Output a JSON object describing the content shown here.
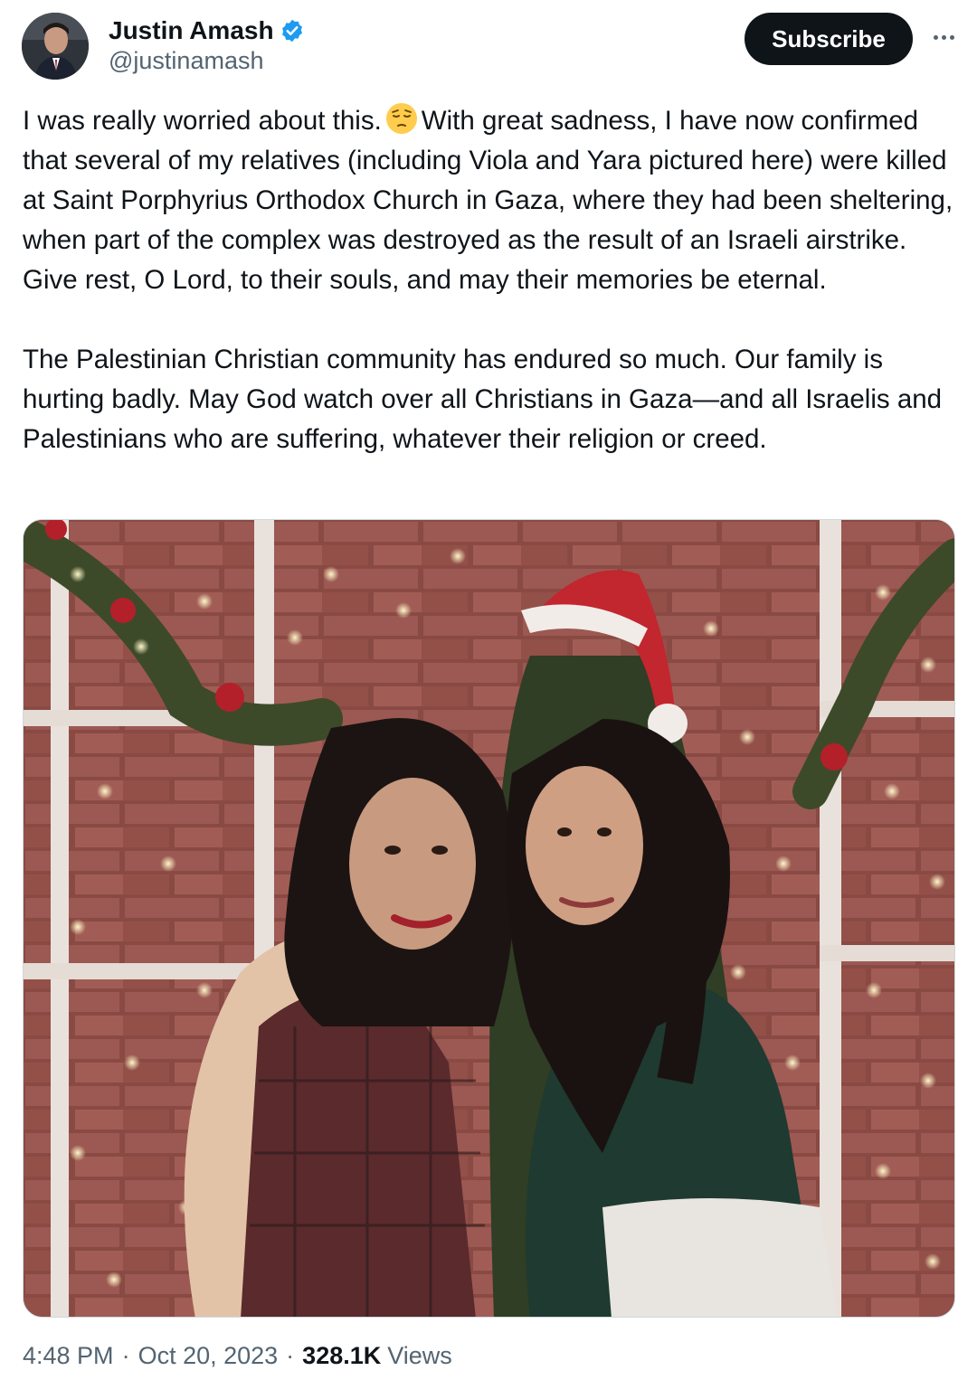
{
  "author": {
    "display_name": "Justin Amash",
    "handle": "@justinamash",
    "verified_icon": "verified-badge-icon",
    "verified_color": "#1d9bf0"
  },
  "actions": {
    "subscribe_label": "Subscribe",
    "more_icon": "more-dots-icon"
  },
  "tweet": {
    "para1_before_emoji": "I was really worried about this.",
    "emoji_icon": "pensive-face-emoji",
    "para1_after_emoji": "With great sadness, I have now confirmed that several of my relatives (including Viola and Yara pictured here) were killed at Saint Porphyrius Orthodox Church in Gaza, where they had been sheltering, when part of the complex was destroyed as the result of an Israeli airstrike. Give rest, O Lord, to their souls, and may their memories be eternal.",
    "para2": "The Palestinian Christian community has endured so much. Our family is hurting badly. May God watch over all Christians in Gaza—and all Israelis and Palestinians who are suffering, whatever their religion or creed."
  },
  "meta": {
    "time": "4:48 PM",
    "separator": "·",
    "date": "Oct 20, 2023",
    "views_count": "328.1K",
    "views_label": "Views"
  },
  "colors": {
    "text": "#0f1419",
    "secondary": "#536471",
    "button_bg": "#0f1419"
  }
}
